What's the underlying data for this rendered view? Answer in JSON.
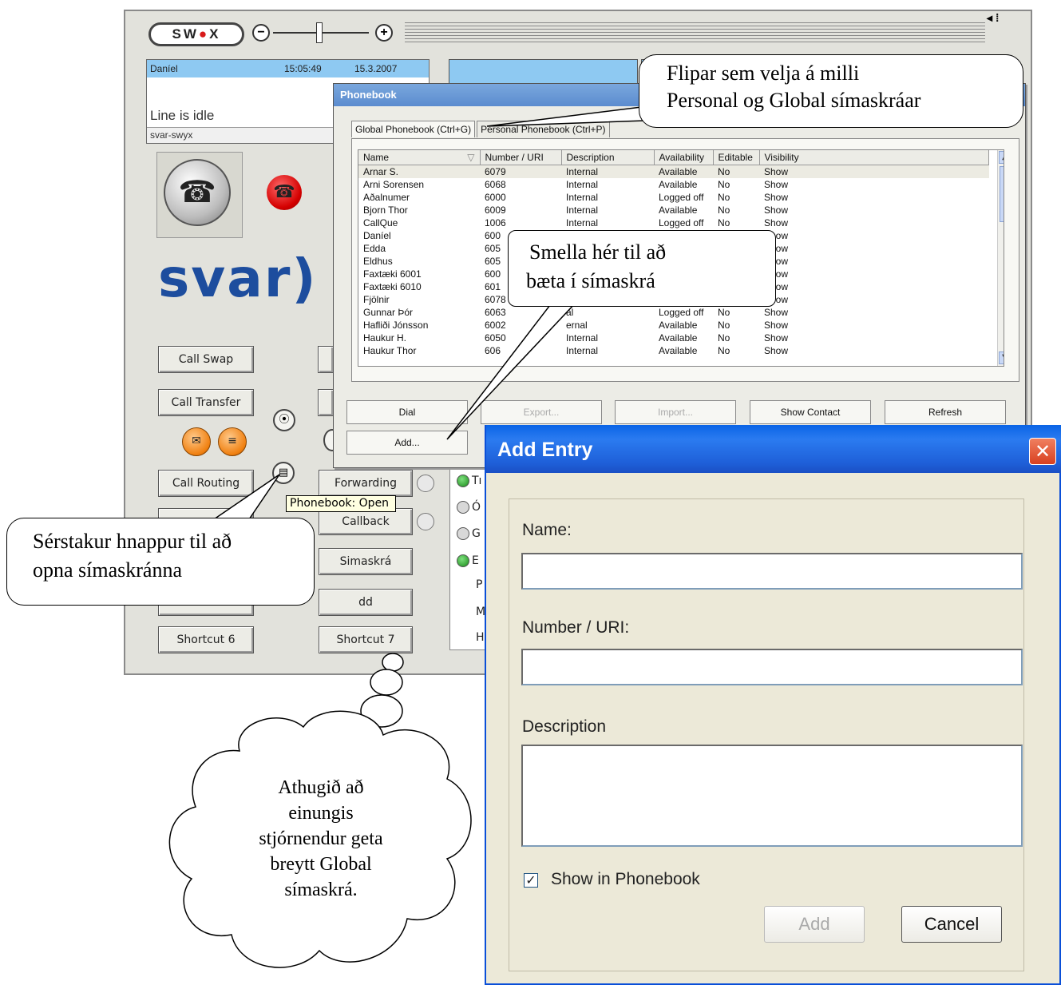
{
  "swyx": {
    "logo": "SW●X",
    "volume_minus": "⊖",
    "volume_plus": "⊕",
    "line1": {
      "name": "Daníel",
      "time": "15:05:49",
      "date": "15.3.2007",
      "status": "Line is idle",
      "account": "svar-swyx"
    },
    "brand": "svar)",
    "buttons": {
      "call_swap": "Call Swap",
      "call_transfer": "Call Transfer",
      "call_routing": "Call Routing",
      "forwarding": "Forwarding",
      "callback": "Callback",
      "simaskra": "Simaskrá",
      "dd": "dd",
      "shortcut6": "Shortcut 6",
      "shortcut7": "Shortcut 7"
    },
    "status_letters": [
      "Tı",
      "Ó",
      "G",
      "E",
      "P",
      "M",
      "H"
    ],
    "tooltip": "Phonebook: Open"
  },
  "phonebook": {
    "title": "Phonebook",
    "tabs": [
      "Global Phonebook  (Ctrl+G)",
      "Personal Phonebook  (Ctrl+P)"
    ],
    "columns": [
      "Name",
      "Number / URI",
      "Description",
      "Availability",
      "Editable",
      "Visibility"
    ],
    "rows": [
      [
        "Arnar S.",
        "6079",
        "Internal",
        "Available",
        "No",
        "Show"
      ],
      [
        "Arni Sorensen",
        "6068",
        "Internal",
        "Available",
        "No",
        "Show"
      ],
      [
        "Aðalnumer",
        "6000",
        "Internal",
        "Logged off",
        "No",
        "Show"
      ],
      [
        "Bjorn Thor",
        "6009",
        "Internal",
        "Available",
        "No",
        "Show"
      ],
      [
        "CallQue",
        "1006",
        "Internal",
        "Logged off",
        "No",
        "Show"
      ],
      [
        "Daníel",
        "600",
        "",
        "",
        "",
        "Show"
      ],
      [
        "Edda",
        "605",
        "",
        "",
        "",
        "Show"
      ],
      [
        "Eldhus",
        "605",
        "",
        "",
        "",
        "Show"
      ],
      [
        "Faxtæki 6001",
        "600",
        "",
        "",
        "",
        "Show"
      ],
      [
        "Faxtæki 6010",
        "601",
        "",
        "",
        "",
        "Show"
      ],
      [
        "Fjölnir",
        "6078",
        "",
        "",
        "",
        "Show"
      ],
      [
        "Gunnar Þór",
        "6063",
        "al",
        "Logged off",
        "No",
        "Show"
      ],
      [
        "Hafliði Jónsson",
        "6002",
        "ernal",
        "Available",
        "No",
        "Show"
      ],
      [
        "Haukur H.",
        "6050",
        "Internal",
        "Available",
        "No",
        "Show"
      ],
      [
        "Haukur Thor",
        "606",
        "Internal",
        "Available",
        "No",
        "Show"
      ]
    ],
    "buttons": {
      "dial": "Dial",
      "export": "Export...",
      "import": "Import...",
      "show_contact": "Show Contact",
      "refresh": "Refresh",
      "add": "Add..."
    }
  },
  "add_entry": {
    "title": "Add Entry",
    "name_label": "Name:",
    "number_label": "Number / URI:",
    "description_label": "Description",
    "show_label": "Show in Phonebook",
    "add_button": "Add",
    "cancel_button": "Cancel"
  },
  "annotations": {
    "tabs_callout": [
      "Flipar sem velja á milli",
      "Personal og Global símaskráar"
    ],
    "add_callout": [
      "Smella hér til að",
      "bæta í símaskrá"
    ],
    "button_callout": [
      "Sérstakur hnappur til að",
      "opna símaskránna"
    ],
    "cloud": [
      "Athugið að",
      "einungis",
      "stjórnendur geta",
      "breytt Global",
      "símaskrá."
    ]
  }
}
